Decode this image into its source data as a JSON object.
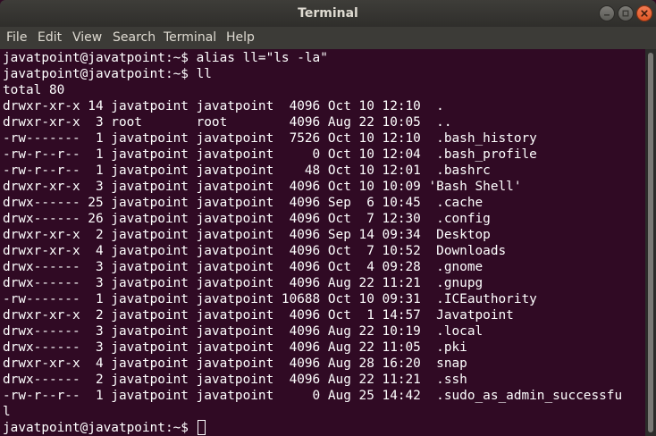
{
  "window": {
    "title": "Terminal"
  },
  "menu": [
    {
      "label": "File"
    },
    {
      "label": "Edit"
    },
    {
      "label": "View"
    },
    {
      "label": "Search"
    },
    {
      "label": "Terminal"
    },
    {
      "label": "Help"
    }
  ],
  "terminal": {
    "prompt_final": "javatpoint@javatpoint:~$ ",
    "lines": [
      "javatpoint@javatpoint:~$ alias ll=\"ls -la\"",
      "javatpoint@javatpoint:~$ ll",
      "total 80",
      "drwxr-xr-x 14 javatpoint javatpoint  4096 Oct 10 12:10  .",
      "drwxr-xr-x  3 root       root        4096 Aug 22 10:05  ..",
      "-rw-------  1 javatpoint javatpoint  7526 Oct 10 12:10  .bash_history",
      "-rw-r--r--  1 javatpoint javatpoint     0 Oct 10 12:04  .bash_profile",
      "-rw-r--r--  1 javatpoint javatpoint    48 Oct 10 12:01  .bashrc",
      "drwxr-xr-x  3 javatpoint javatpoint  4096 Oct 10 10:09 'Bash Shell'",
      "drwx------ 25 javatpoint javatpoint  4096 Sep  6 10:45  .cache",
      "drwx------ 26 javatpoint javatpoint  4096 Oct  7 12:30  .config",
      "drwxr-xr-x  2 javatpoint javatpoint  4096 Sep 14 09:34  Desktop",
      "drwxr-xr-x  4 javatpoint javatpoint  4096 Oct  7 10:52  Downloads",
      "drwx------  3 javatpoint javatpoint  4096 Oct  4 09:28  .gnome",
      "drwx------  3 javatpoint javatpoint  4096 Aug 22 11:21  .gnupg",
      "-rw-------  1 javatpoint javatpoint 10688 Oct 10 09:31  .ICEauthority",
      "drwxr-xr-x  2 javatpoint javatpoint  4096 Oct  1 14:57  Javatpoint",
      "drwx------  3 javatpoint javatpoint  4096 Aug 22 10:19  .local",
      "drwx------  3 javatpoint javatpoint  4096 Aug 22 11:05  .pki",
      "drwxr-xr-x  4 javatpoint javatpoint  4096 Aug 28 16:20  snap",
      "drwx------  2 javatpoint javatpoint  4096 Aug 22 11:21  .ssh",
      "-rw-r--r--  1 javatpoint javatpoint     0 Aug 25 14:42  .sudo_as_admin_successfu",
      "l"
    ]
  },
  "colors": {
    "terminal_bg": "#300a24",
    "terminal_fg": "#ffffff",
    "titlebar_bg": "#3e3d39",
    "menubar_bg": "#3c3b37",
    "close_button": "#e95420"
  }
}
